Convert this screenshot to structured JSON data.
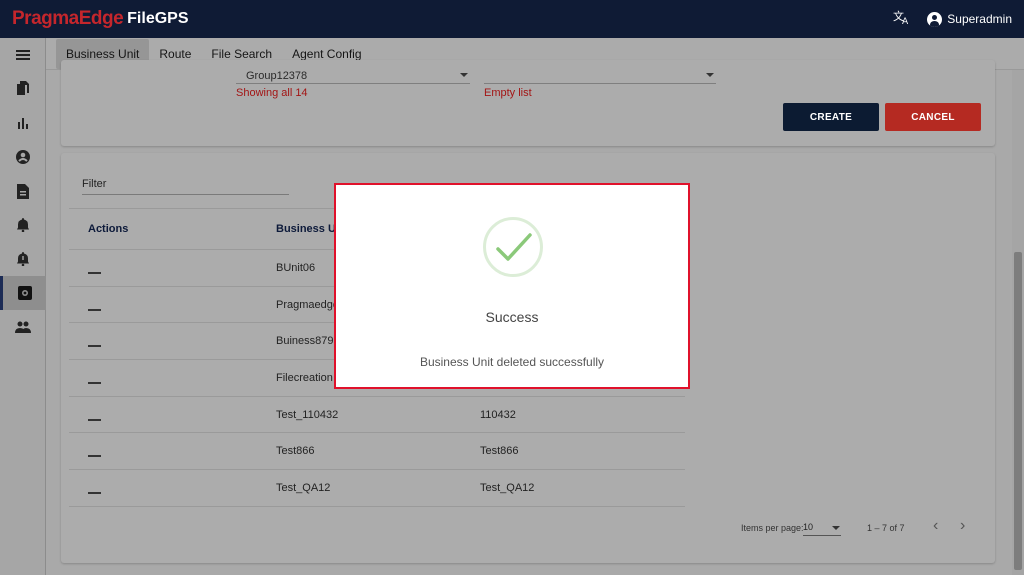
{
  "app": {
    "brand": "PragmaEdge",
    "product": "FileGPS",
    "user": "Superadmin"
  },
  "tabs": [
    {
      "label": "Business Unit",
      "active": true
    },
    {
      "label": "Route",
      "active": false
    },
    {
      "label": "File Search",
      "active": false
    },
    {
      "label": "Agent Config",
      "active": false
    }
  ],
  "sidebar": {
    "items": [
      {
        "icon": "menu-icon"
      },
      {
        "icon": "files-icon"
      },
      {
        "icon": "bar-chart-icon"
      },
      {
        "icon": "account-circle-icon"
      },
      {
        "icon": "document-icon"
      },
      {
        "icon": "notification-icon"
      },
      {
        "icon": "notification-alert-icon"
      },
      {
        "icon": "settings-icon",
        "active": true
      },
      {
        "icon": "group-icon"
      }
    ]
  },
  "form": {
    "group_select_value": "Group12378",
    "group_hint": "Showing all 14",
    "second_select_value": "",
    "second_hint": "Empty list",
    "create_label": "CREATE",
    "cancel_label": "CANCEL"
  },
  "table": {
    "filter_label": "Filter",
    "headers": [
      "Actions",
      "Business Uni"
    ],
    "rows": [
      {
        "name": "BUnit06",
        "code": ""
      },
      {
        "name": "Pragmaedge1",
        "code": ""
      },
      {
        "name": "Buiness8798",
        "code": ""
      },
      {
        "name": "Filecreation",
        "code": ""
      },
      {
        "name": "Test_110432",
        "code": "110432"
      },
      {
        "name": "Test866",
        "code": "Test866"
      },
      {
        "name": "Test_QA12",
        "code": "Test_QA12"
      }
    ]
  },
  "pagination": {
    "items_per_page_label": "Items per page:",
    "items_per_page_value": "10",
    "range": "1 – 7 of 7"
  },
  "modal": {
    "title": "Success",
    "message": "Business Unit deleted successfully",
    "colors": {
      "border": "#e0112b",
      "check": "#8bc97a"
    }
  }
}
